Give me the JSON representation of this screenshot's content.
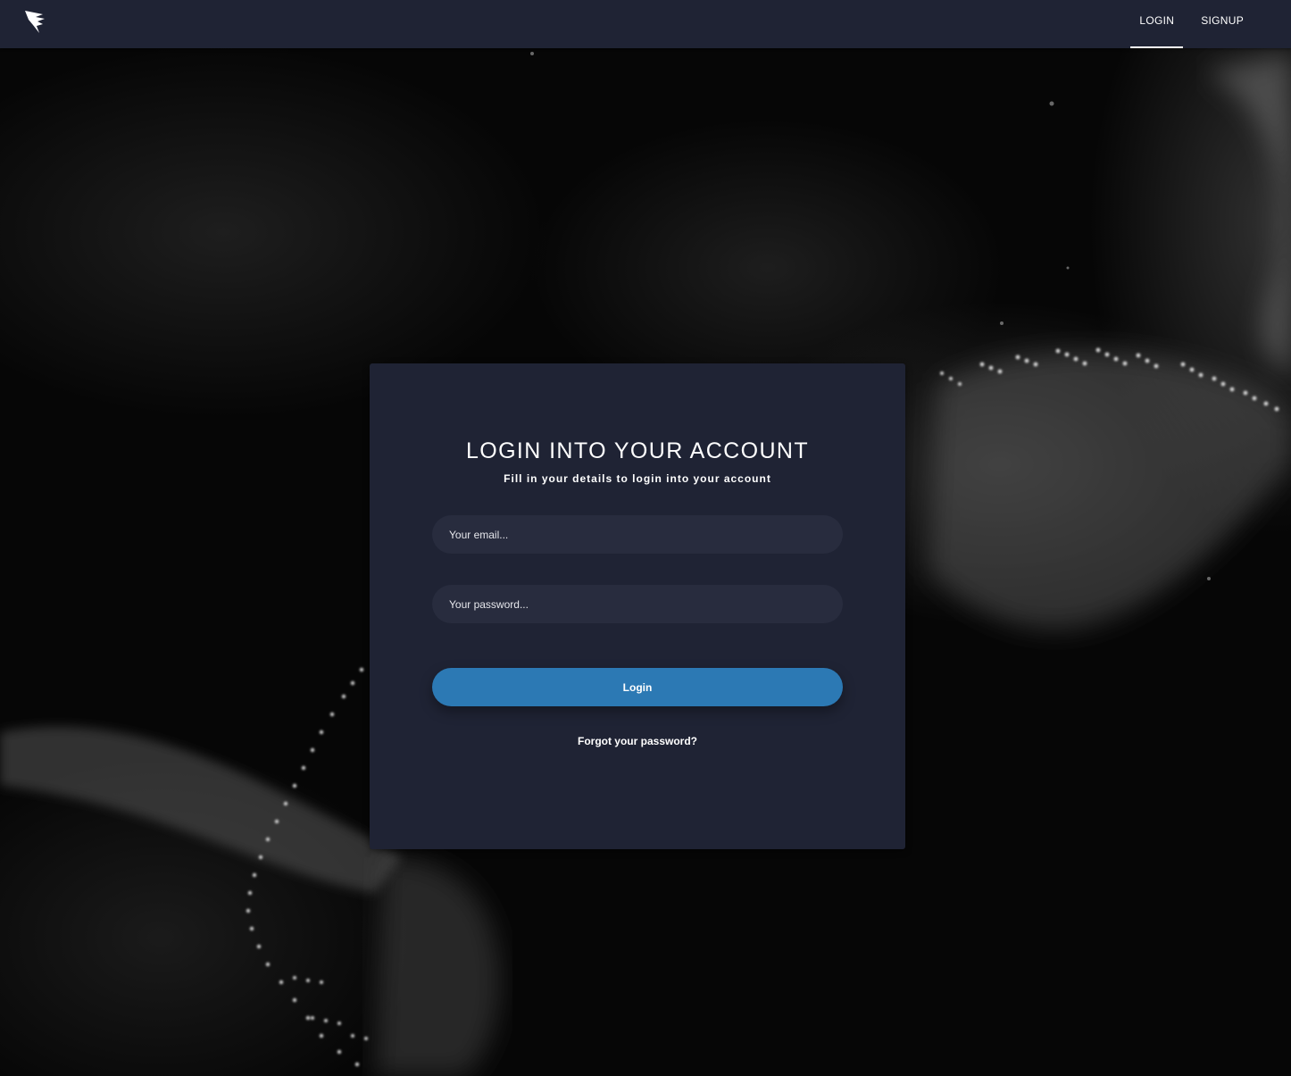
{
  "navbar": {
    "logo_icon": "bird-logo-icon",
    "links": [
      {
        "label": "LOGIN",
        "active": true
      },
      {
        "label": "SIGNUP",
        "active": false
      }
    ],
    "background": "#1f2334"
  },
  "login_card": {
    "title": "LOGIN INTO YOUR ACCOUNT",
    "subtitle": "Fill in your details to login into your account",
    "email_placeholder": "Your email...",
    "password_placeholder": "Your password...",
    "login_button_label": "Login",
    "forgot_password_label": "Forgot your password?",
    "accent_color": "#2c79b4"
  }
}
